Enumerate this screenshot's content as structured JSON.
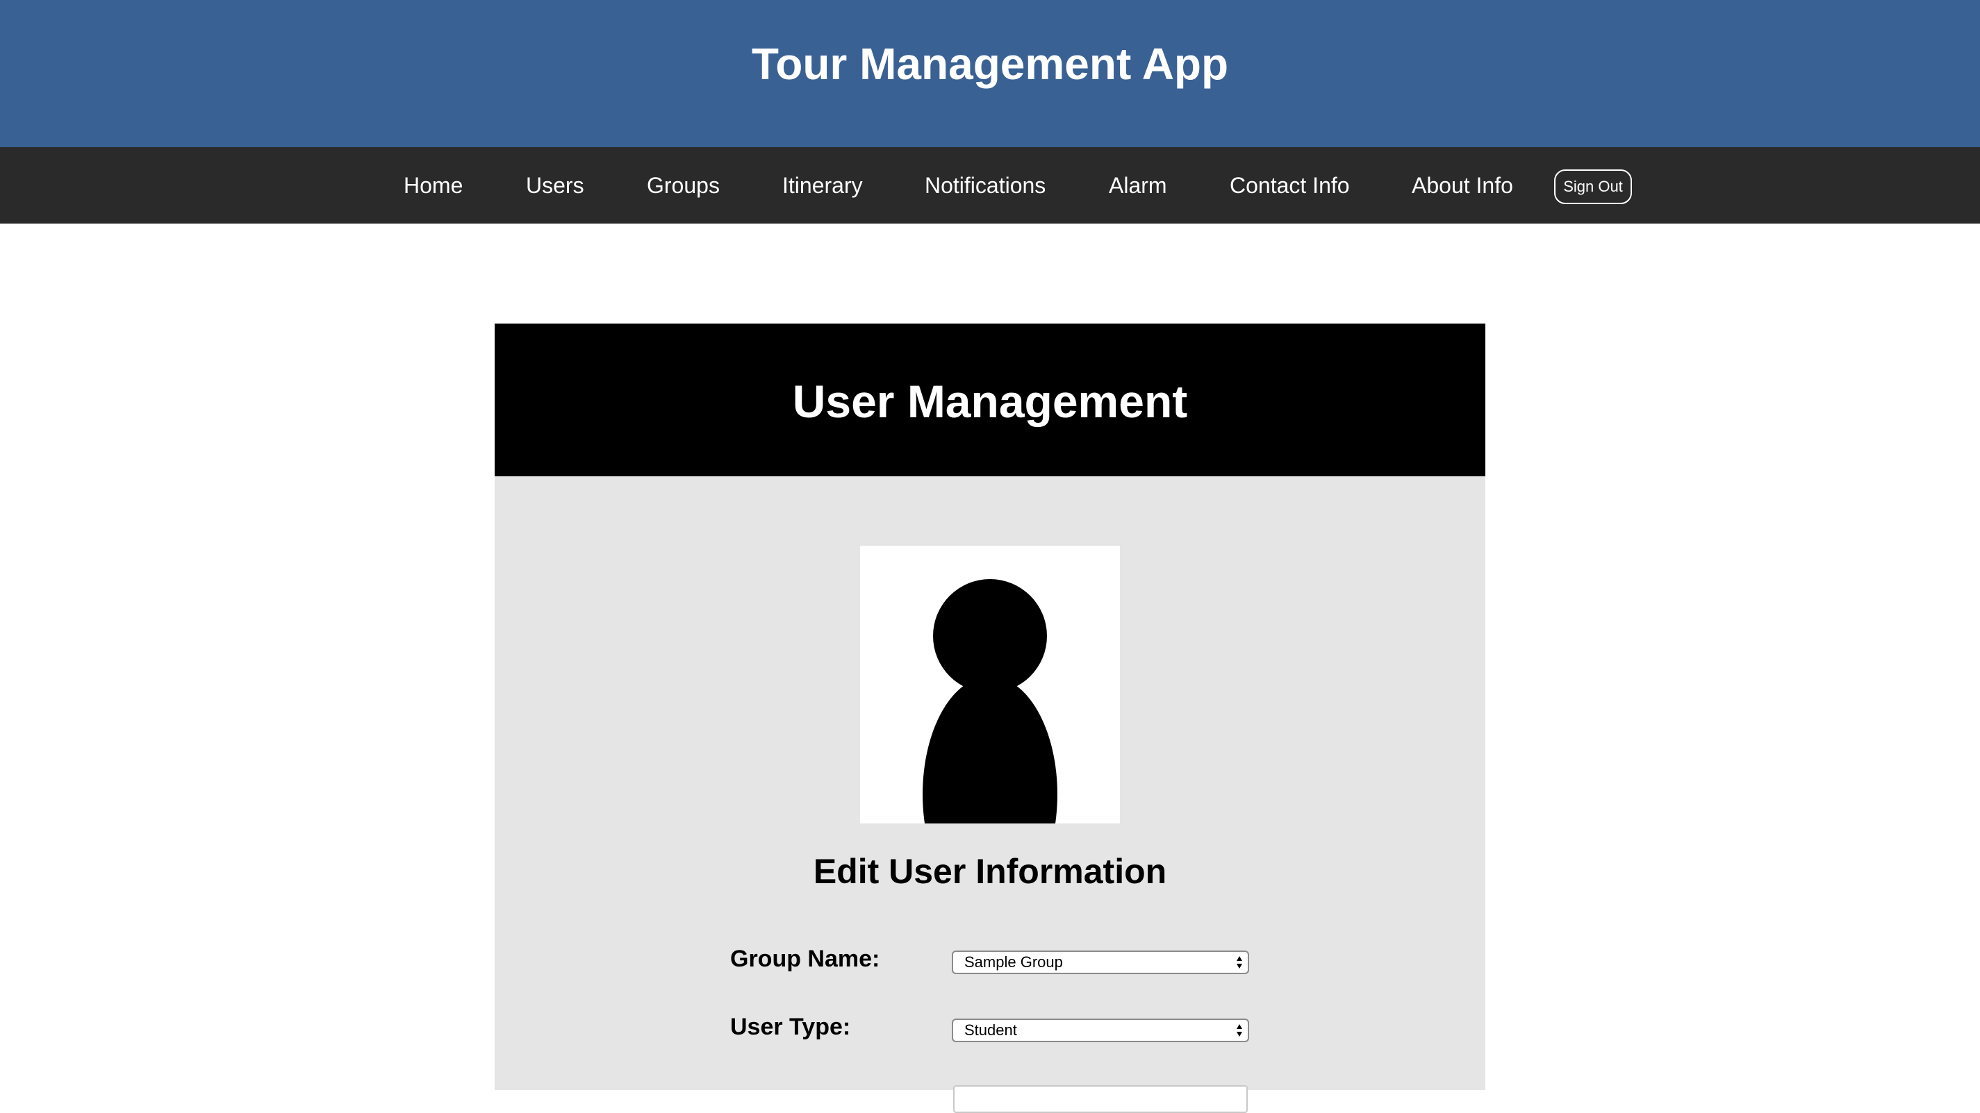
{
  "app": {
    "title": "Tour Management App"
  },
  "nav": {
    "items": [
      "Home",
      "Users",
      "Groups",
      "Itinerary",
      "Notifications",
      "Alarm",
      "Contact Info",
      "About Info"
    ],
    "signout_label": "Sign Out"
  },
  "panel": {
    "title": "User Management",
    "avatar_icon": "person-silhouette-icon",
    "form_title": "Edit User Information",
    "fields": [
      {
        "label": "Group Name:",
        "value": "Sample Group"
      },
      {
        "label": "User Type:",
        "value": "Student"
      }
    ]
  },
  "colors": {
    "header": "#3a6193",
    "nav": "#2a2a2a",
    "panel_header": "#000000",
    "panel_body": "#e5e5e5"
  }
}
